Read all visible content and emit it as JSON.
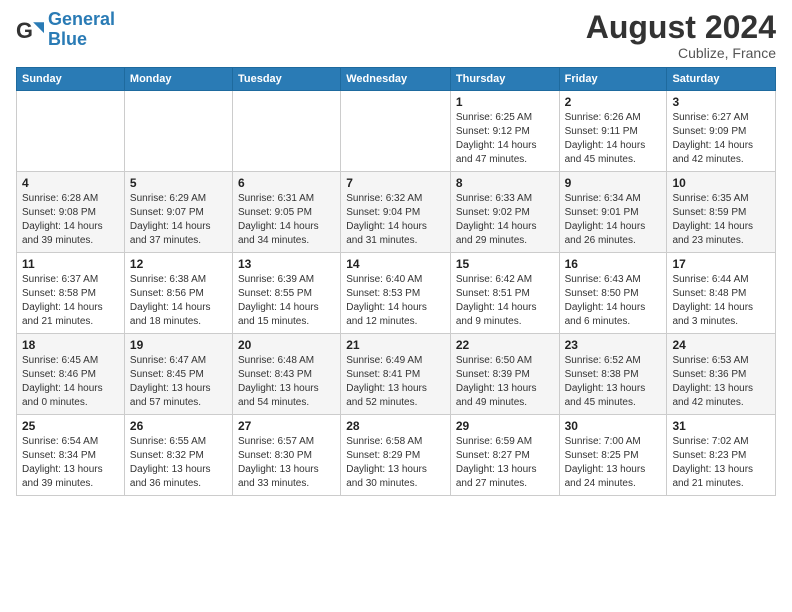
{
  "header": {
    "logo_general": "General",
    "logo_blue": "Blue",
    "month_year": "August 2024",
    "location": "Cublize, France"
  },
  "weekdays": [
    "Sunday",
    "Monday",
    "Tuesday",
    "Wednesday",
    "Thursday",
    "Friday",
    "Saturday"
  ],
  "weeks": [
    [
      {
        "day": "",
        "info": ""
      },
      {
        "day": "",
        "info": ""
      },
      {
        "day": "",
        "info": ""
      },
      {
        "day": "",
        "info": ""
      },
      {
        "day": "1",
        "info": "Sunrise: 6:25 AM\nSunset: 9:12 PM\nDaylight: 14 hours\nand 47 minutes."
      },
      {
        "day": "2",
        "info": "Sunrise: 6:26 AM\nSunset: 9:11 PM\nDaylight: 14 hours\nand 45 minutes."
      },
      {
        "day": "3",
        "info": "Sunrise: 6:27 AM\nSunset: 9:09 PM\nDaylight: 14 hours\nand 42 minutes."
      }
    ],
    [
      {
        "day": "4",
        "info": "Sunrise: 6:28 AM\nSunset: 9:08 PM\nDaylight: 14 hours\nand 39 minutes."
      },
      {
        "day": "5",
        "info": "Sunrise: 6:29 AM\nSunset: 9:07 PM\nDaylight: 14 hours\nand 37 minutes."
      },
      {
        "day": "6",
        "info": "Sunrise: 6:31 AM\nSunset: 9:05 PM\nDaylight: 14 hours\nand 34 minutes."
      },
      {
        "day": "7",
        "info": "Sunrise: 6:32 AM\nSunset: 9:04 PM\nDaylight: 14 hours\nand 31 minutes."
      },
      {
        "day": "8",
        "info": "Sunrise: 6:33 AM\nSunset: 9:02 PM\nDaylight: 14 hours\nand 29 minutes."
      },
      {
        "day": "9",
        "info": "Sunrise: 6:34 AM\nSunset: 9:01 PM\nDaylight: 14 hours\nand 26 minutes."
      },
      {
        "day": "10",
        "info": "Sunrise: 6:35 AM\nSunset: 8:59 PM\nDaylight: 14 hours\nand 23 minutes."
      }
    ],
    [
      {
        "day": "11",
        "info": "Sunrise: 6:37 AM\nSunset: 8:58 PM\nDaylight: 14 hours\nand 21 minutes."
      },
      {
        "day": "12",
        "info": "Sunrise: 6:38 AM\nSunset: 8:56 PM\nDaylight: 14 hours\nand 18 minutes."
      },
      {
        "day": "13",
        "info": "Sunrise: 6:39 AM\nSunset: 8:55 PM\nDaylight: 14 hours\nand 15 minutes."
      },
      {
        "day": "14",
        "info": "Sunrise: 6:40 AM\nSunset: 8:53 PM\nDaylight: 14 hours\nand 12 minutes."
      },
      {
        "day": "15",
        "info": "Sunrise: 6:42 AM\nSunset: 8:51 PM\nDaylight: 14 hours\nand 9 minutes."
      },
      {
        "day": "16",
        "info": "Sunrise: 6:43 AM\nSunset: 8:50 PM\nDaylight: 14 hours\nand 6 minutes."
      },
      {
        "day": "17",
        "info": "Sunrise: 6:44 AM\nSunset: 8:48 PM\nDaylight: 14 hours\nand 3 minutes."
      }
    ],
    [
      {
        "day": "18",
        "info": "Sunrise: 6:45 AM\nSunset: 8:46 PM\nDaylight: 14 hours\nand 0 minutes."
      },
      {
        "day": "19",
        "info": "Sunrise: 6:47 AM\nSunset: 8:45 PM\nDaylight: 13 hours\nand 57 minutes."
      },
      {
        "day": "20",
        "info": "Sunrise: 6:48 AM\nSunset: 8:43 PM\nDaylight: 13 hours\nand 54 minutes."
      },
      {
        "day": "21",
        "info": "Sunrise: 6:49 AM\nSunset: 8:41 PM\nDaylight: 13 hours\nand 52 minutes."
      },
      {
        "day": "22",
        "info": "Sunrise: 6:50 AM\nSunset: 8:39 PM\nDaylight: 13 hours\nand 49 minutes."
      },
      {
        "day": "23",
        "info": "Sunrise: 6:52 AM\nSunset: 8:38 PM\nDaylight: 13 hours\nand 45 minutes."
      },
      {
        "day": "24",
        "info": "Sunrise: 6:53 AM\nSunset: 8:36 PM\nDaylight: 13 hours\nand 42 minutes."
      }
    ],
    [
      {
        "day": "25",
        "info": "Sunrise: 6:54 AM\nSunset: 8:34 PM\nDaylight: 13 hours\nand 39 minutes."
      },
      {
        "day": "26",
        "info": "Sunrise: 6:55 AM\nSunset: 8:32 PM\nDaylight: 13 hours\nand 36 minutes."
      },
      {
        "day": "27",
        "info": "Sunrise: 6:57 AM\nSunset: 8:30 PM\nDaylight: 13 hours\nand 33 minutes."
      },
      {
        "day": "28",
        "info": "Sunrise: 6:58 AM\nSunset: 8:29 PM\nDaylight: 13 hours\nand 30 minutes."
      },
      {
        "day": "29",
        "info": "Sunrise: 6:59 AM\nSunset: 8:27 PM\nDaylight: 13 hours\nand 27 minutes."
      },
      {
        "day": "30",
        "info": "Sunrise: 7:00 AM\nSunset: 8:25 PM\nDaylight: 13 hours\nand 24 minutes."
      },
      {
        "day": "31",
        "info": "Sunrise: 7:02 AM\nSunset: 8:23 PM\nDaylight: 13 hours\nand 21 minutes."
      }
    ]
  ]
}
